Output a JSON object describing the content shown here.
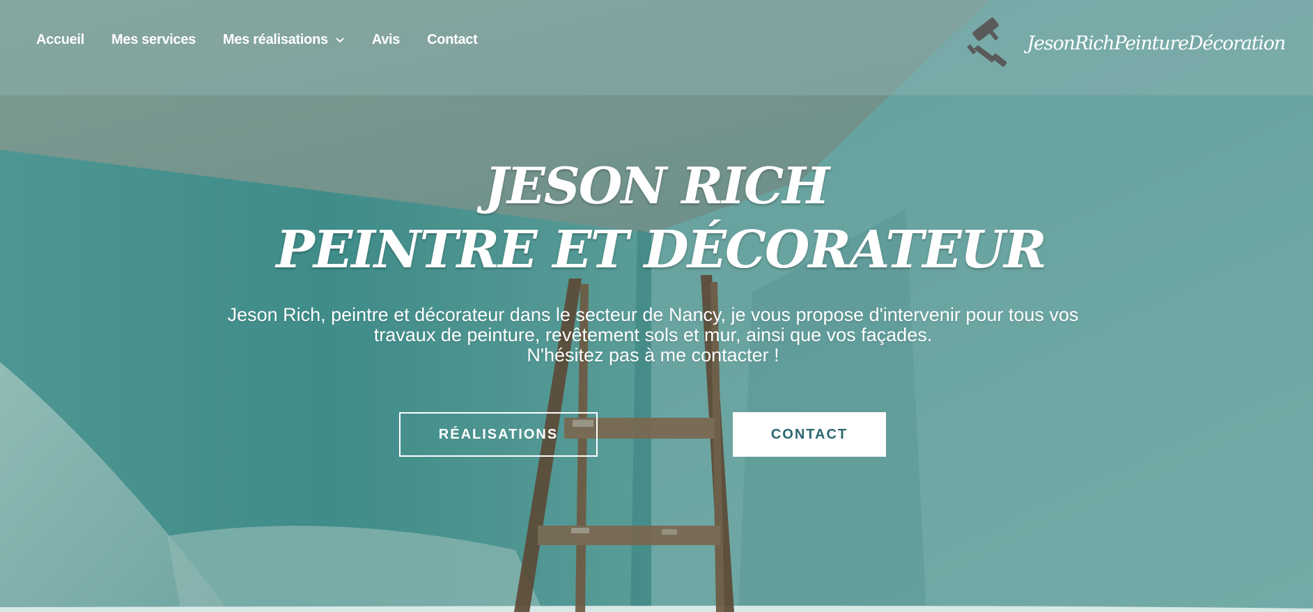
{
  "nav": {
    "items": [
      {
        "label": "Accueil"
      },
      {
        "label": "Mes services"
      },
      {
        "label": "Mes réalisations",
        "has_dropdown": true
      },
      {
        "label": "Avis"
      },
      {
        "label": "Contact"
      }
    ]
  },
  "brand": {
    "name": "JesonRichPeintureDécoration",
    "icon": "paint-roller-icon"
  },
  "hero": {
    "title_line1": "JESON RICH",
    "title_line2": "PEINTRE ET DÉCORATEUR",
    "description_lines": [
      "Jeson Rich, peintre et décorateur dans le secteur de Nancy, je vous propose d'intervenir pour tous vos",
      "travaux de peinture, revêtement sols et mur, ainsi que vos façades.",
      "N'hésitez pas à me contacter !"
    ],
    "buttons": {
      "realisations": "RÉALISATIONS",
      "contact": "CONTACT"
    }
  },
  "colors": {
    "accent": "#2b6770",
    "background": "#5f9e9a",
    "text": "#ffffff"
  }
}
